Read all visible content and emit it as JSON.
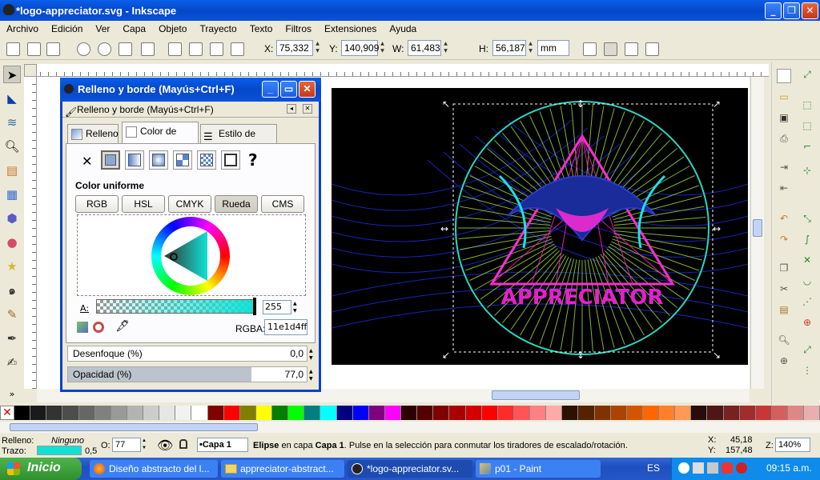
{
  "window": {
    "title": "*logo-appreciator.svg - Inkscape"
  },
  "menu": [
    "Archivo",
    "Edición",
    "Ver",
    "Capa",
    "Objeto",
    "Trayecto",
    "Texto",
    "Filtros",
    "Extensiones",
    "Ayuda"
  ],
  "toolbar": {
    "x_label": "X:",
    "x_value": "75,332",
    "y_label": "Y:",
    "y_value": "140,909",
    "w_label": "W:",
    "w_value": "61,483",
    "h_label": "H:",
    "h_value": "56,187",
    "unit": "mm"
  },
  "dialog": {
    "title": "Relleno y borde (Mayús+Ctrl+F)",
    "subtitle": "Relleno y borde (Mayús+Ctrl+F)",
    "tabs": [
      "Relleno",
      "Color de trazo",
      "Estilo de trazo"
    ],
    "paint_none": "✕",
    "paint_unknown": "?",
    "section_label": "Color uniforme",
    "modes": [
      "RGB",
      "HSL",
      "CMYK",
      "Rueda",
      "CMS"
    ],
    "alpha_label": "A:",
    "alpha_value": "255",
    "rgba_label": "RGBA:",
    "rgba_value": "11e1d4ff",
    "blur_label": "Desenfoque (%)",
    "blur_value": "0,0",
    "opacity_label": "Opacidad (%)",
    "opacity_value": "77,0",
    "opacity_level": 0.77,
    "stroke_color": "#11e1d4"
  },
  "artwork": {
    "text": "APPRECIATOR"
  },
  "status": {
    "fill_label": "Relleno:",
    "fill_value": "Ninguno",
    "stroke_label": "Trazo:",
    "stroke_width": "0,5",
    "opacity_label": "O:",
    "opacity_value": "77",
    "layer": "•Capa 1",
    "message_strong": "Elipse",
    "message_rest": " en capa ",
    "message_layer": "Capa 1",
    "message_end": ". Pulse en la selección para conmutar los tiradores de escalado/rotación.",
    "x_label": "X:",
    "x_value": "45,18",
    "y_label": "Y:",
    "y_value": "157,48",
    "zoom_label": "Z:",
    "zoom_value": "140%"
  },
  "taskbar": {
    "start": "Inicio",
    "tasks": [
      "Diseño abstracto del l...",
      "appreciator-abstract...",
      "*logo-appreciator.sv...",
      "p01 - Paint"
    ],
    "lang": "ES",
    "time": "09:15 a.m."
  },
  "palette": [
    "#000000",
    "#1a1a1a",
    "#333333",
    "#4d4d4d",
    "#666666",
    "#808080",
    "#999999",
    "#b3b3b3",
    "#cccccc",
    "#e6e6e6",
    "#f2f2f2",
    "#ffffff",
    "#800000",
    "#ff0000",
    "#808000",
    "#ffff00",
    "#008000",
    "#00ff00",
    "#008080",
    "#00ffff",
    "#000080",
    "#0000ff",
    "#800080",
    "#ff00ff",
    "#2b0000",
    "#550000",
    "#800000",
    "#aa0000",
    "#d40000",
    "#ff0000",
    "#ff2a2a",
    "#ff5555",
    "#ff8080",
    "#ffaaaa",
    "#2b1100",
    "#552200",
    "#803300",
    "#aa4400",
    "#d45500",
    "#ff6600",
    "#ff7f2a",
    "#ff9955",
    "#280b0b",
    "#501616",
    "#782121",
    "#a02c2c",
    "#c83737",
    "#d35f5f",
    "#de8787",
    "#e9afaf"
  ]
}
